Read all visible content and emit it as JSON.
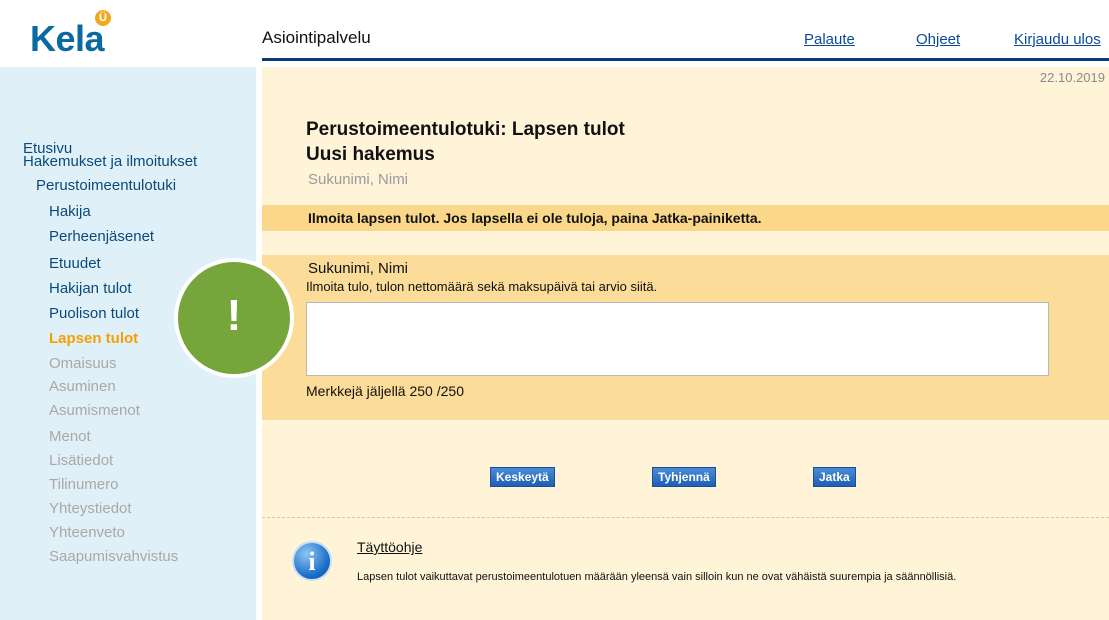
{
  "header": {
    "logo_text": "Kela",
    "logo_badge": "Ü",
    "app_title": "Asiointipalvelu",
    "links": [
      "Palaute",
      "Ohjeet",
      "Kirjaudu ulos"
    ]
  },
  "sidebar": {
    "home": "Etusivu",
    "section": "Hakemukset ja ilmoitukset",
    "subsection": "Perustoimeentulotuki",
    "steps": [
      {
        "label": "Hakija",
        "state": "done"
      },
      {
        "label": "Perheenjäsenet",
        "state": "done"
      },
      {
        "label": "Etuudet",
        "state": "done"
      },
      {
        "label": "Hakijan tulot",
        "state": "done"
      },
      {
        "label": "Puolison tulot",
        "state": "done"
      },
      {
        "label": "Lapsen tulot",
        "state": "active"
      },
      {
        "label": "Omaisuus",
        "state": "future"
      },
      {
        "label": "Asuminen",
        "state": "future"
      },
      {
        "label": "Asumismenot",
        "state": "future"
      },
      {
        "label": "Menot",
        "state": "future"
      },
      {
        "label": "Lisätiedot",
        "state": "future"
      },
      {
        "label": "Tilinumero",
        "state": "future"
      },
      {
        "label": "Yhteystiedot",
        "state": "future"
      },
      {
        "label": "Yhteenveto",
        "state": "future"
      },
      {
        "label": "Saapumisvahvistus",
        "state": "future"
      }
    ]
  },
  "main": {
    "date": "22.10.2019",
    "title": "Perustoimeentulotuki: Lapsen tulot",
    "subtitle": "Uusi hakemus",
    "applicant_name": "Sukunimi, Nimi",
    "instruction": "Ilmoita lapsen tulot. Jos lapsella ei ole tuloja, paina Jatka-painiketta.",
    "form": {
      "child_name": "Sukunimi, Nimi",
      "hint": "Ilmoita tulo, tulon nettomäärä sekä maksupäivä tai arvio siitä.",
      "textarea_value": "",
      "counter": "Merkkejä jäljellä 250 /250"
    },
    "buttons": {
      "cancel": "Keskeytä",
      "clear": "Tyhjennä",
      "continue": "Jatka"
    },
    "help": {
      "title": "Täyttöohje",
      "text": "Lapsen tulot vaikuttavat perustoimeentulotuen määrään yleensä vain silloin kun ne ovat vähäistä suurempia ja säännöllisiä."
    }
  },
  "overlay": {
    "alert_symbol": "!",
    "color": "#76a53c"
  },
  "colors": {
    "brand_blue": "#0a6aa0",
    "sidebar_bg": "#dff0f8",
    "main_bg": "#fff4d8",
    "band_bg": "#fbd78a",
    "active_step": "#f5a000",
    "button_blue": "#1f5fb4"
  }
}
